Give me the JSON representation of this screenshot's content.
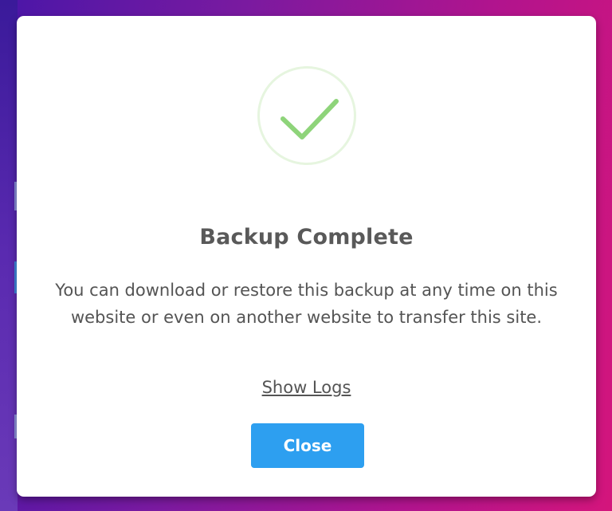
{
  "dialog": {
    "title": "Backup Complete",
    "message": "You can download or restore this backup at any time on this website or even on another website to transfer this site.",
    "show_logs_label": "Show Logs",
    "close_label": "Close"
  },
  "icons": {
    "status": "success-checkmark-icon"
  },
  "colors": {
    "accent": "#2d9ff0",
    "success": "#8ed47a",
    "success_ring": "#e6f5df",
    "title_text": "#595959",
    "body_text": "#545454"
  }
}
